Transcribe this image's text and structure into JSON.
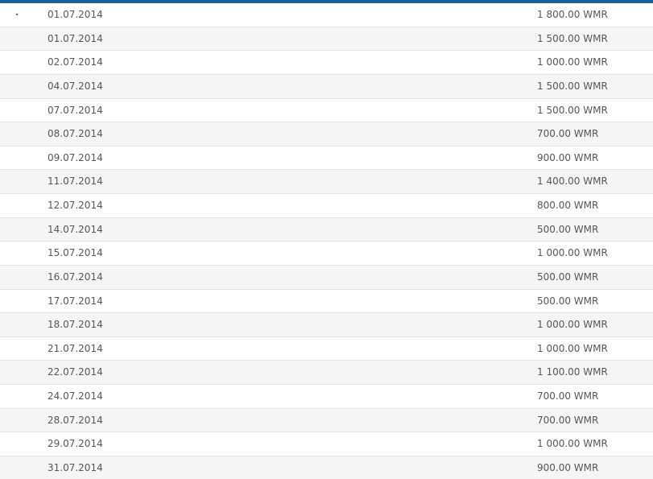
{
  "colors": {
    "top_border": "#1e5f9e",
    "row_alt": "#f5f5f5",
    "row_divider": "#e3e3e3",
    "text": "#555555"
  },
  "rows": [
    {
      "date": "01.07.2014",
      "amount": "1 800.00 WMR"
    },
    {
      "date": "01.07.2014",
      "amount": "1 500.00 WMR"
    },
    {
      "date": "02.07.2014",
      "amount": "1 000.00 WMR"
    },
    {
      "date": "04.07.2014",
      "amount": "1 500.00 WMR"
    },
    {
      "date": "07.07.2014",
      "amount": "1 500.00 WMR"
    },
    {
      "date": "08.07.2014",
      "amount": "700.00 WMR"
    },
    {
      "date": "09.07.2014",
      "amount": "900.00 WMR"
    },
    {
      "date": "11.07.2014",
      "amount": "1 400.00 WMR"
    },
    {
      "date": "12.07.2014",
      "amount": "800.00 WMR"
    },
    {
      "date": "14.07.2014",
      "amount": "500.00 WMR"
    },
    {
      "date": "15.07.2014",
      "amount": "1 000.00 WMR"
    },
    {
      "date": "16.07.2014",
      "amount": "500.00 WMR"
    },
    {
      "date": "17.07.2014",
      "amount": "500.00 WMR"
    },
    {
      "date": "18.07.2014",
      "amount": "1 000.00 WMR"
    },
    {
      "date": "21.07.2014",
      "amount": "1 000.00 WMR"
    },
    {
      "date": "22.07.2014",
      "amount": "1 100.00 WMR"
    },
    {
      "date": "24.07.2014",
      "amount": "700.00 WMR"
    },
    {
      "date": "28.07.2014",
      "amount": "700.00 WMR"
    },
    {
      "date": "29.07.2014",
      "amount": "1 000.00 WMR"
    },
    {
      "date": "31.07.2014",
      "amount": "900.00 WMR"
    }
  ]
}
